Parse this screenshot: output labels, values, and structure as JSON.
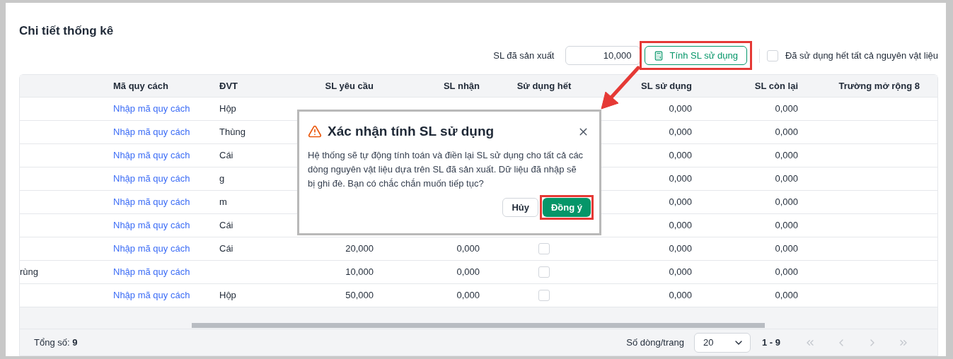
{
  "title": "Chi tiết thống kê",
  "toolbar": {
    "produced_label": "SL đã sản xuất",
    "produced_value": "10,000",
    "calc_button": "Tính SL sử dụng",
    "all_used": {
      "label": "Đã sử dụng hết tất cả nguyên vật liệu",
      "checked": false
    }
  },
  "table": {
    "columns": [
      "",
      "Mã quy cách",
      "ĐVT",
      "SL yêu cầu",
      "SL nhận",
      "Sử dụng hết",
      "SL sử dụng",
      "SL còn lại",
      "Trường mở rộng 8"
    ],
    "rows": [
      {
        "column_1": "",
        "spec": "Nhập mã quy cách",
        "unit": "Hộp",
        "used": "0,000",
        "remaining": "0,000"
      },
      {
        "column_1": "",
        "spec": "Nhập mã quy cách",
        "unit": "Thùng",
        "used": "0,000",
        "remaining": "0,000"
      },
      {
        "column_1": "",
        "spec": "Nhập mã quy cách",
        "unit": "Cái",
        "used": "0,000",
        "remaining": "0,000"
      },
      {
        "column_1": "",
        "spec": "Nhập mã quy cách",
        "unit": "g",
        "used": "0,000",
        "remaining": "0,000"
      },
      {
        "column_1": "",
        "spec": "Nhập mã quy cách",
        "unit": "m",
        "used": "0,000",
        "remaining": "0,000"
      },
      {
        "column_1": "",
        "spec": "Nhập mã quy cách",
        "unit": "Cái",
        "used": "0,000",
        "remaining": "0,000"
      },
      {
        "column_1": "",
        "spec": "Nhập mã quy cách",
        "unit": "Cái",
        "requested": "20,000",
        "received": "0,000",
        "used_up": false,
        "used": "0,000",
        "remaining": "0,000"
      },
      {
        "column_1": "rùng",
        "spec": "Nhập mã quy cách",
        "unit": "",
        "requested": "10,000",
        "received": "0,000",
        "used_up": false,
        "used": "0,000",
        "remaining": "0,000"
      },
      {
        "column_1": "",
        "spec": "Nhập mã quy cách",
        "unit": "Hộp",
        "requested": "50,000",
        "received": "0,000",
        "used_up": false,
        "used": "0,000",
        "remaining": "0,000"
      }
    ]
  },
  "footer": {
    "total_label": "Tổng số:",
    "total": "9",
    "page_size_label": "Số dòng/trang",
    "page_size": "20",
    "range": "1 - 9",
    "nav": [
      {
        "kind": "first",
        "disabled": true
      },
      {
        "kind": "prev",
        "disabled": true
      },
      {
        "kind": "next",
        "disabled": true
      },
      {
        "kind": "last",
        "disabled": true
      }
    ]
  },
  "dialog": {
    "title": "Xác nhận tính SL sử dụng",
    "message": "Hệ thống sẽ tự động tính toán và điền lại SL sử dụng cho tất cả các dòng nguyên vật liệu dựa trên SL đã sản xuất. Dữ liệu đã nhập sẽ bị ghi đè. Bạn có chắc chắn muốn tiếp tục?",
    "cancel": "Hủy",
    "confirm": "Đồng ý"
  }
}
